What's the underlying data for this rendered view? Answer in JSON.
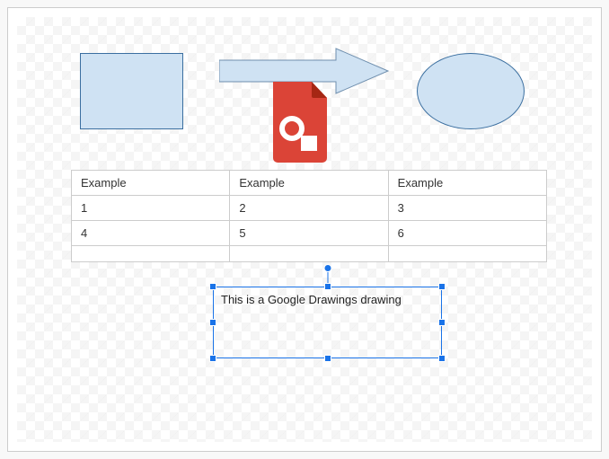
{
  "shapes": {
    "rect_fill": "#cfe2f3",
    "rect_stroke": "#3b6fa0",
    "arrow_fill": "#cfe2f3",
    "arrow_stroke": "#6f8fae",
    "ellipse_fill": "#cfe2f3",
    "ellipse_stroke": "#3b6fa0"
  },
  "icon": {
    "name": "google-drawings-file-icon",
    "bg": "#db4437",
    "fold": "#a52714"
  },
  "table": {
    "headers": [
      "Example",
      "Example",
      "Example"
    ],
    "rows": [
      [
        "1",
        "2",
        "3"
      ],
      [
        "4",
        "5",
        "6"
      ],
      [
        "",
        "",
        ""
      ]
    ]
  },
  "textbox": {
    "content": "This is a Google Drawings drawing",
    "selected": true,
    "selection_color": "#1a73e8"
  }
}
